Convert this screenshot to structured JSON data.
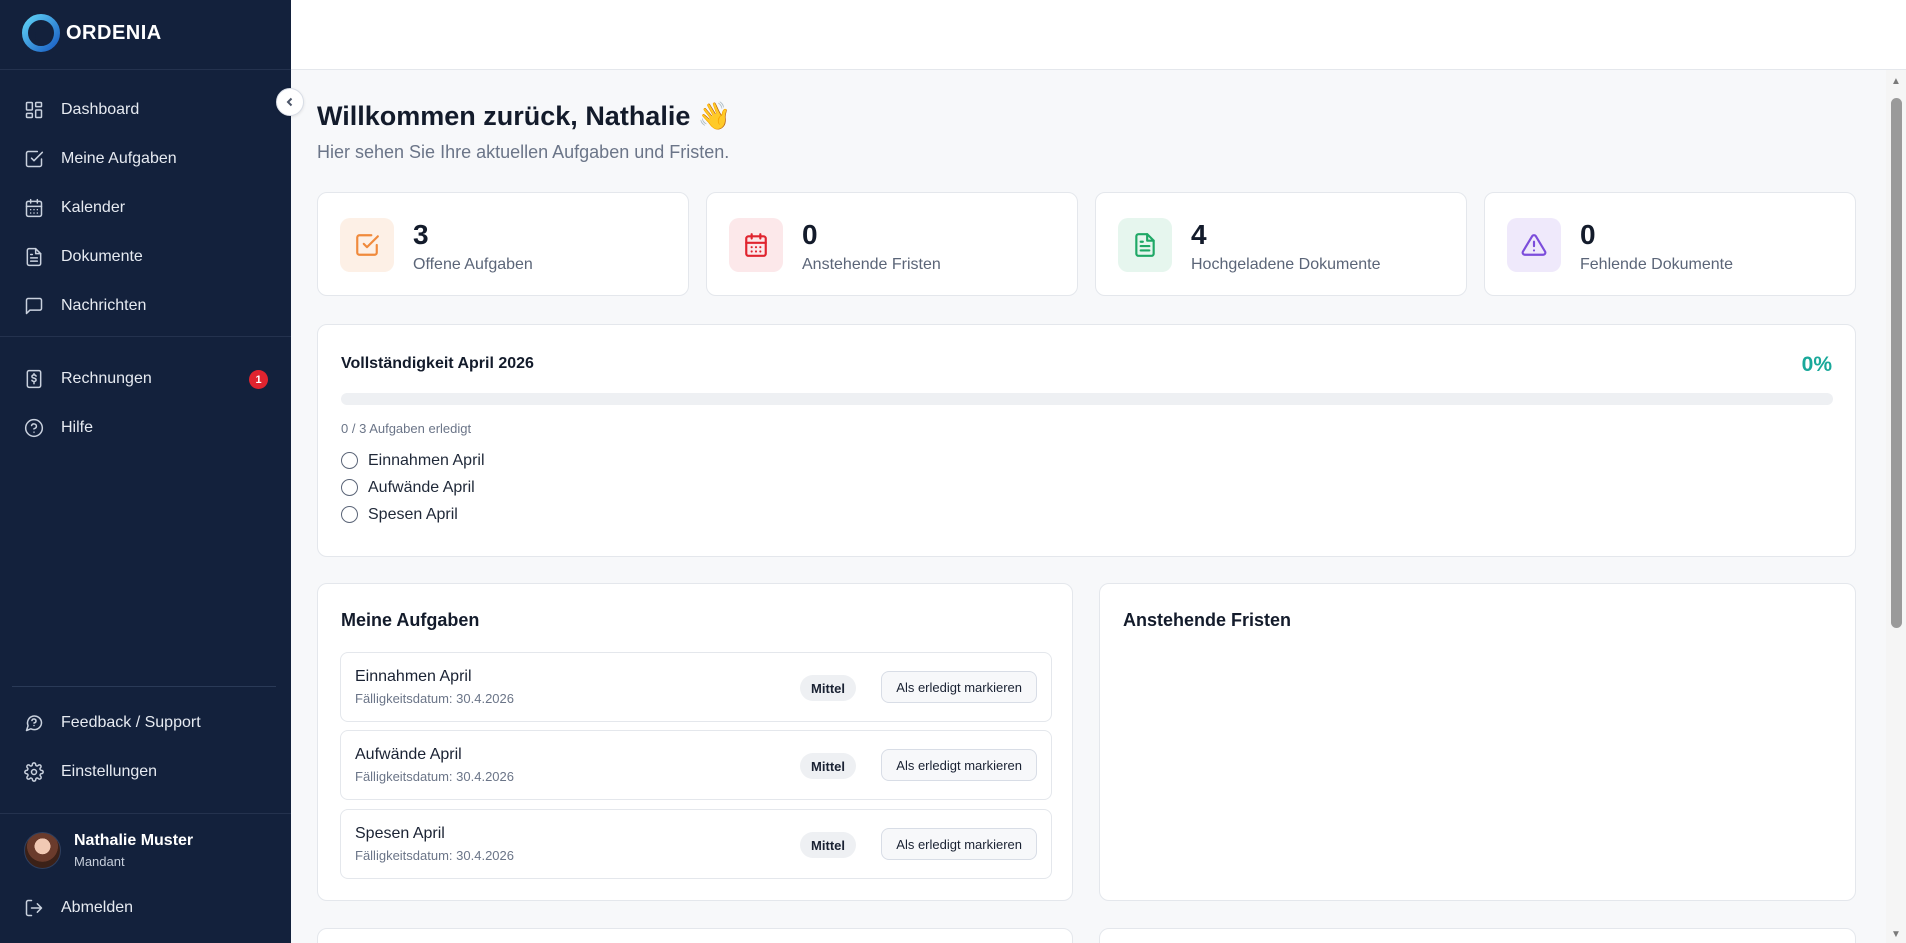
{
  "brand": {
    "name": "ORDENIA"
  },
  "sidebar": {
    "items": [
      {
        "label": "Dashboard",
        "icon": "dashboard-icon"
      },
      {
        "label": "Meine Aufgaben",
        "icon": "checkbox-icon"
      },
      {
        "label": "Kalender",
        "icon": "calendar-icon"
      },
      {
        "label": "Dokumente",
        "icon": "document-icon"
      },
      {
        "label": "Nachrichten",
        "icon": "message-icon"
      },
      {
        "label": "Rechnungen",
        "icon": "invoice-icon",
        "badge": "1"
      },
      {
        "label": "Hilfe",
        "icon": "help-icon"
      }
    ],
    "bottom": [
      {
        "label": "Feedback / Support",
        "icon": "support-icon"
      },
      {
        "label": "Einstellungen",
        "icon": "gear-icon"
      }
    ],
    "user": {
      "name": "Nathalie Muster",
      "role": "Mandant"
    },
    "logout": "Abmelden"
  },
  "header": {
    "welcome": "Willkommen zurück, Nathalie 👋",
    "subtitle": "Hier sehen Sie Ihre aktuellen Aufgaben und Fristen."
  },
  "stats": [
    {
      "value": "3",
      "label": "Offene Aufgaben",
      "icon": "task-check-icon",
      "color": "#f08a3c",
      "bg": "#fdf0e6"
    },
    {
      "value": "0",
      "label": "Anstehende Fristen",
      "icon": "calendar-icon",
      "color": "#e0242f",
      "bg": "#fce8ea"
    },
    {
      "value": "4",
      "label": "Hochgeladene Dokumente",
      "icon": "document-icon",
      "color": "#1fa866",
      "bg": "#e6f6ee"
    },
    {
      "value": "0",
      "label": "Fehlende Dokumente",
      "icon": "warning-icon",
      "color": "#7c4ddb",
      "bg": "#efe9fb"
    }
  ],
  "completion": {
    "title": "Vollständigkeit April 2026",
    "percent": "0%",
    "progress": 0,
    "count": "0 / 3 Aufgaben erledigt",
    "items": [
      "Einnahmen April",
      "Aufwände April",
      "Spesen April"
    ]
  },
  "tasks": {
    "title": "Meine Aufgaben",
    "items": [
      {
        "name": "Einnahmen April",
        "due": "Fälligkeitsdatum: 30.4.2026",
        "priority": "Mittel",
        "action": "Als erledigt markieren"
      },
      {
        "name": "Aufwände April",
        "due": "Fälligkeitsdatum: 30.4.2026",
        "priority": "Mittel",
        "action": "Als erledigt markieren"
      },
      {
        "name": "Spesen April",
        "due": "Fälligkeitsdatum: 30.4.2026",
        "priority": "Mittel",
        "action": "Als erledigt markieren"
      }
    ]
  },
  "deadlines": {
    "title": "Anstehende Fristen"
  }
}
